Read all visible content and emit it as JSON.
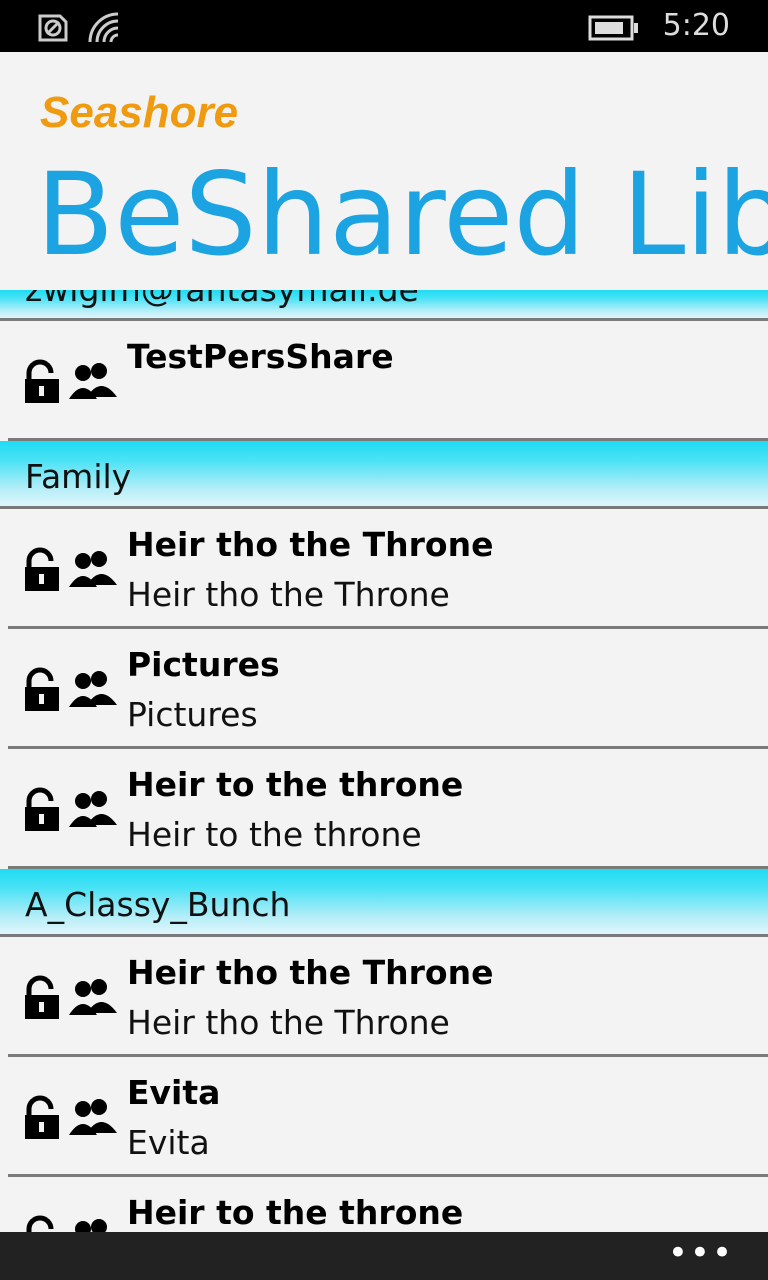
{
  "status_bar": {
    "time": "5:20",
    "icons": [
      "sync-icon",
      "wifi-icon",
      "battery-icon"
    ]
  },
  "header": {
    "app_label": "Seashore",
    "page_title": "BeShared Libra"
  },
  "list": {
    "top_partial_header": "zwigim@fantasymail.de",
    "top_item": {
      "title": "TestPersShare",
      "subtitle": ""
    },
    "groups": [
      {
        "name": "Family",
        "items": [
          {
            "title": "Heir tho the Throne",
            "subtitle": "Heir tho the Throne"
          },
          {
            "title": "Pictures",
            "subtitle": "Pictures"
          },
          {
            "title": "Heir to the throne",
            "subtitle": "Heir to the throne"
          }
        ]
      },
      {
        "name": "A_Classy_Bunch",
        "items": [
          {
            "title": "Heir tho the Throne",
            "subtitle": "Heir tho the Throne"
          },
          {
            "title": "Evita",
            "subtitle": "Evita"
          },
          {
            "title": "Heir to the throne",
            "subtitle": ""
          }
        ]
      }
    ]
  },
  "app_bar": {
    "more_label": "•••"
  },
  "colors": {
    "accent": "#1ca3e2",
    "app_label": "#f09a10",
    "group_header": "#1fdcf3"
  }
}
